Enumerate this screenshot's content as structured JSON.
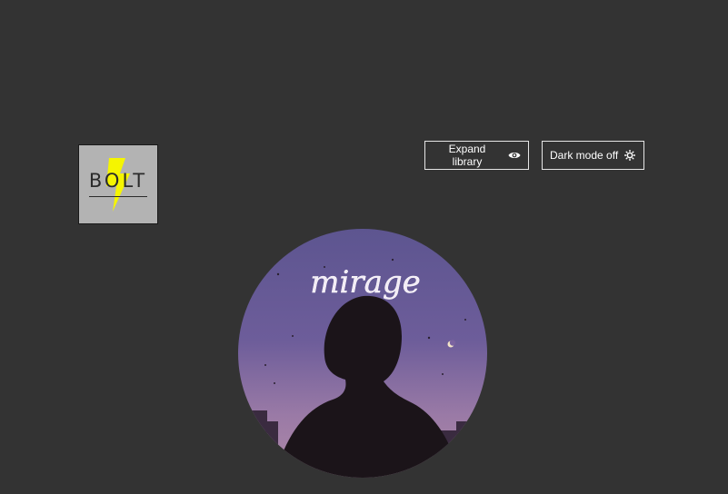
{
  "logo": {
    "text": "BOLT",
    "bolt_color": "#f5f500"
  },
  "toolbar": {
    "expand_label": "Expand library",
    "expand_icon": "eye-icon",
    "dark_mode_label": "Dark mode off",
    "dark_mode_icon": "sun-icon"
  },
  "album": {
    "title_art_text": "mirage"
  },
  "colors": {
    "background": "#333333",
    "button_border": "#e6e6e6",
    "button_text": "#ffffff"
  }
}
